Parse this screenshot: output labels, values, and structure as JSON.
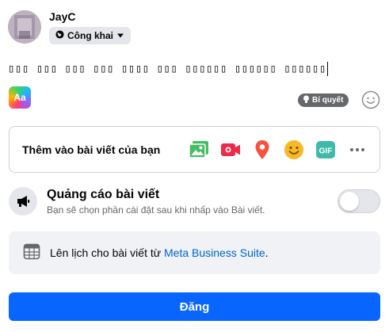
{
  "header": {
    "username": "JayC",
    "privacy_label": "Công khai",
    "privacy_icon": "globe-icon",
    "dropdown_icon": "caret-down-icon"
  },
  "composer": {
    "text": "▯▯▯ ▯▯▯ ▯▯▯ ▯▯▯ ▯▯▯▯ ▯▯▯ ▯▯▯▯▯▯ ▯▯▯▯▯▯ ▯▯▯▯▯▯",
    "aa_label": "Aa",
    "tips_label": "Bí quyết",
    "tips_icon": "lightbulb-icon",
    "emoji_icon": "smiley-icon"
  },
  "add_to_post": {
    "label": "Thêm vào bài viết của bạn",
    "icons": [
      "photo-icon",
      "live-video-icon",
      "location-pin-icon",
      "feeling-icon",
      "gif-icon",
      "more-icon"
    ],
    "gif_label": "GIF",
    "more_label": "•••",
    "colors": {
      "photo": "#45bd62",
      "live": "#f02849",
      "location": "#f5533d",
      "feeling": "#f7b928",
      "gif": "#3ebaab"
    }
  },
  "promote": {
    "title": "Quảng cáo bài viết",
    "subtitle": "Bạn sẽ chọn phần cài đặt sau khi nhấp vào Bài viết.",
    "icon": "megaphone-icon",
    "toggle_on": false
  },
  "schedule": {
    "text": "Lên lịch cho bài viết từ ",
    "link": "Meta Business Suite",
    "suffix": ".",
    "icon": "calendar-icon"
  },
  "post_button": {
    "label": "Đăng",
    "color": "#0866ff"
  }
}
